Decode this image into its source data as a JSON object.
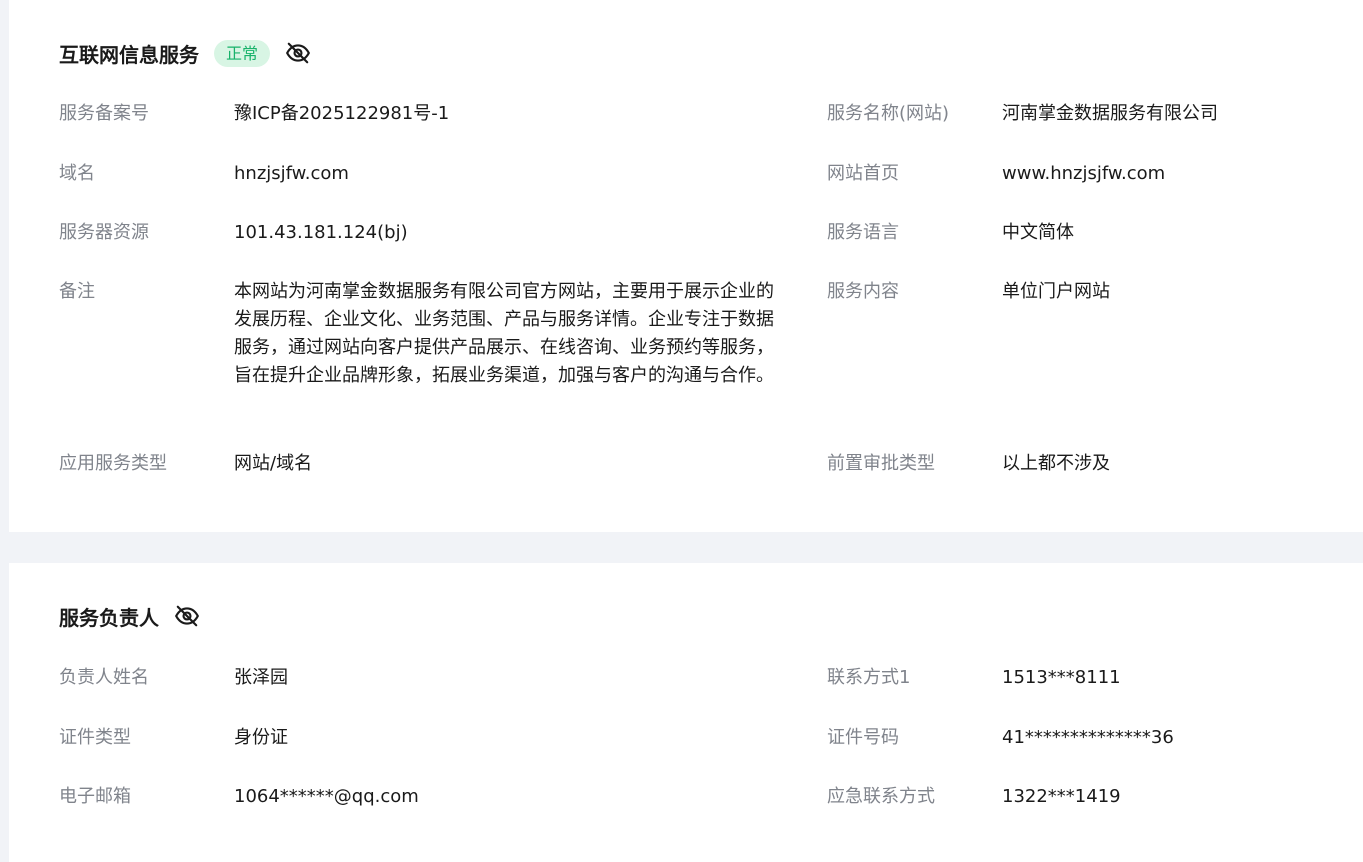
{
  "internet_service": {
    "title": "互联网信息服务",
    "status": "正常",
    "fields": {
      "filing_number_label": "服务备案号",
      "filing_number": "豫ICP备2025122981号-1",
      "service_name_label": "服务名称(网站)",
      "service_name": "河南掌金数据服务有限公司",
      "domain_label": "域名",
      "domain": "hnzjsjfw.com",
      "homepage_label": "网站首页",
      "homepage": "www.hnzjsjfw.com",
      "server_label": "服务器资源",
      "server": "101.43.181.124(bj)",
      "language_label": "服务语言",
      "language": "中文简体",
      "remark_label": "备注",
      "remark": "本网站为河南掌金数据服务有限公司官方网站，主要用于展示企业的发展历程、企业文化、业务范围、产品与服务详情。企业专注于数据服务，通过网站向客户提供产品展示、在线咨询、业务预约等服务，旨在提升企业品牌形象，拓展业务渠道，加强与客户的沟通与合作。",
      "content_label": "服务内容",
      "content": "单位门户网站",
      "app_type_label": "应用服务类型",
      "app_type": "网站/域名",
      "approval_label": "前置审批类型",
      "approval": "以上都不涉及"
    }
  },
  "service_owner": {
    "title": "服务负责人",
    "fields": {
      "name_label": "负责人姓名",
      "name": "张泽园",
      "contact1_label": "联系方式1",
      "contact1": "1513***8111",
      "id_type_label": "证件类型",
      "id_type": "身份证",
      "id_number_label": "证件号码",
      "id_number": "41**************36",
      "email_label": "电子邮箱",
      "email": "1064******@qq.com",
      "emergency_label": "应急联系方式",
      "emergency": "1322***1419"
    }
  },
  "icons": {
    "visibility_toggle": "eye-off-icon"
  },
  "colors": {
    "status_bg": "#d8f5e4",
    "status_text": "#17b26a",
    "label": "#80848c",
    "value": "#1a1a1a",
    "page_bg": "#f1f3f7"
  }
}
